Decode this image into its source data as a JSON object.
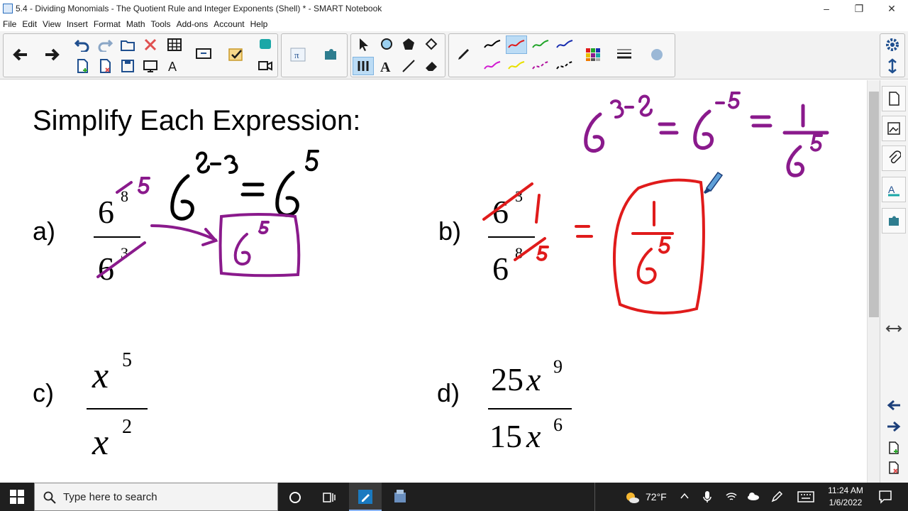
{
  "window": {
    "title": "5.4 - Dividing Monomials - The Quotient Rule and Integer Exponents (Shell) * - SMART Notebook",
    "controls": [
      "–",
      "❐",
      "✕"
    ]
  },
  "menu": [
    "File",
    "Edit",
    "View",
    "Insert",
    "Format",
    "Math",
    "Tools",
    "Add-ons",
    "Account",
    "Help"
  ],
  "page": {
    "heading": "Simplify Each Expression:",
    "problems": {
      "a": {
        "label": "a)",
        "num_base": "6",
        "num_exp": "8",
        "den_base": "6",
        "den_exp": "3"
      },
      "b": {
        "label": "b)",
        "num_base": "6",
        "num_exp": "3",
        "den_base": "6",
        "den_exp": "8"
      },
      "c": {
        "label": "c)",
        "num_base": "x",
        "num_exp": "5",
        "den_base": "x",
        "den_exp": "2"
      },
      "d": {
        "label": "d)",
        "num_coef": "25",
        "num_base": "x",
        "num_exp": "9",
        "den_coef": "15",
        "den_base": "x",
        "den_exp": "6"
      }
    },
    "ink_colors": {
      "black": "#000000",
      "purple": "#8a1a8c",
      "red": "#e01b1b"
    }
  },
  "taskbar": {
    "search_placeholder": "Type here to search",
    "weather": "72°F",
    "time": "11:24 AM",
    "date": "1/6/2022"
  },
  "icons": {
    "back": "arrow-left-icon",
    "forward": "arrow-right-icon",
    "undo": "undo-icon",
    "redo": "redo-icon",
    "settings": "gear-icon"
  }
}
